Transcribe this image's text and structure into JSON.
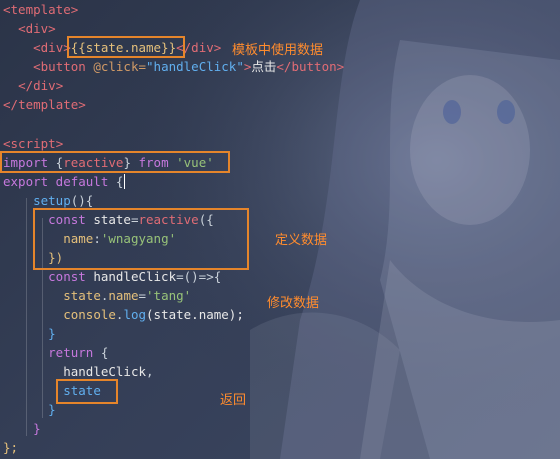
{
  "code": {
    "l1": {
      "open": "<",
      "tag": "template",
      "close": ">"
    },
    "l2": {
      "open": "<",
      "tag": "div",
      "close": ">"
    },
    "l3": {
      "open": "<",
      "tag": "div",
      "close": ">",
      "interp": "{{state.name}}",
      "endopen": "</",
      "endtag": "div",
      "endclose": ">"
    },
    "l4": {
      "open": "<",
      "tag": "button",
      "attr": " @click=",
      "val": "\"handleClick\"",
      "close": ">",
      "text": "点击",
      "endopen": "</",
      "endtag": "button",
      "endclose": ">"
    },
    "l5": {
      "open": "</",
      "tag": "div",
      "close": ">"
    },
    "l6": {
      "open": "</",
      "tag": "template",
      "close": ">"
    },
    "l8": {
      "open": "<",
      "tag": "script",
      "close": ">"
    },
    "l9": {
      "kw": "import",
      "brace_open": " {",
      "name": "reactive",
      "brace_close": "}",
      "from": " from ",
      "str": "'vue'"
    },
    "l10": {
      "kw": "export default",
      "brace": " {"
    },
    "l11": {
      "fn": "setup",
      "punc": "(){"
    },
    "l12": {
      "kw": "const ",
      "var": "state",
      "eq": "=",
      "fn": "reactive",
      "punc": "({"
    },
    "l13": {
      "prop": "name",
      "colon": ":",
      "str": "'wnagyang'"
    },
    "l14": {
      "punc": "})"
    },
    "l15": {
      "kw": "const ",
      "var": "handleClick",
      "punc": "=()=>{"
    },
    "l16": {
      "var": "state",
      "dot": ".",
      "prop": "name",
      "eq": "=",
      "str": "'tang'"
    },
    "l17": {
      "var": "console",
      "dot": ".",
      "fn": "log",
      "args": "(state.name);"
    },
    "l18": {
      "punc": "}"
    },
    "l19": {
      "kw": "return",
      "punc": " {"
    },
    "l20": {
      "var": "handleClick",
      "punc": ","
    },
    "l21": {
      "var": "state"
    },
    "l22": {
      "punc": "}"
    },
    "l23": {
      "punc": "}"
    },
    "l24": {
      "punc": "};"
    }
  },
  "annotations": {
    "template_usage": "模板中使用数据",
    "define_data": "定义数据",
    "modify_data": "修改数据",
    "return_label": "返回"
  },
  "colors": {
    "annotation": "#ff8c2e",
    "highlight_box": "#e5852b",
    "background": "#343e56"
  }
}
